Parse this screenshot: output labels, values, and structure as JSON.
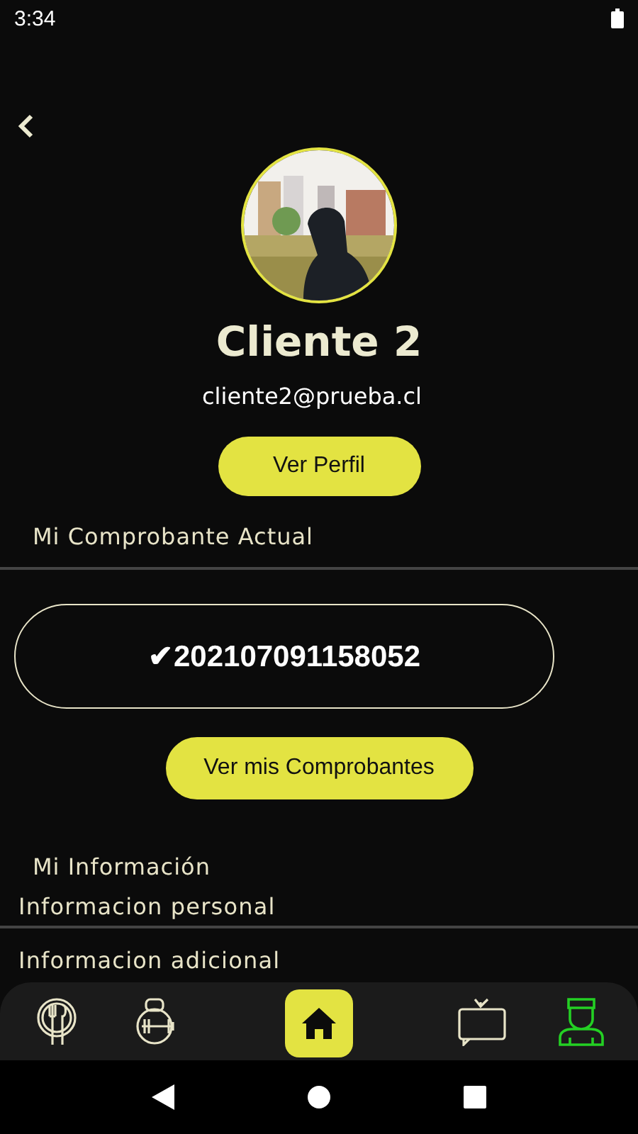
{
  "status_bar": {
    "time": "3:34"
  },
  "profile": {
    "name": "Cliente 2",
    "email": "cliente2@prueba.cl",
    "button": "Ver Perfil"
  },
  "receipt": {
    "heading": "Mi Comprobante Actual",
    "check": "✔",
    "number": "202107091158052",
    "button": "Ver mis Comprobantes"
  },
  "info": {
    "heading": "Mi Información",
    "items": [
      "Informacion personal",
      "Informacion adicional"
    ]
  },
  "bottom_nav": [
    {
      "kind": "plate",
      "selected": false
    },
    {
      "kind": "kettlebell",
      "selected": false
    },
    {
      "kind": "home",
      "selected": false
    },
    {
      "kind": "tv",
      "selected": false
    },
    {
      "kind": "person",
      "selected": true
    }
  ]
}
